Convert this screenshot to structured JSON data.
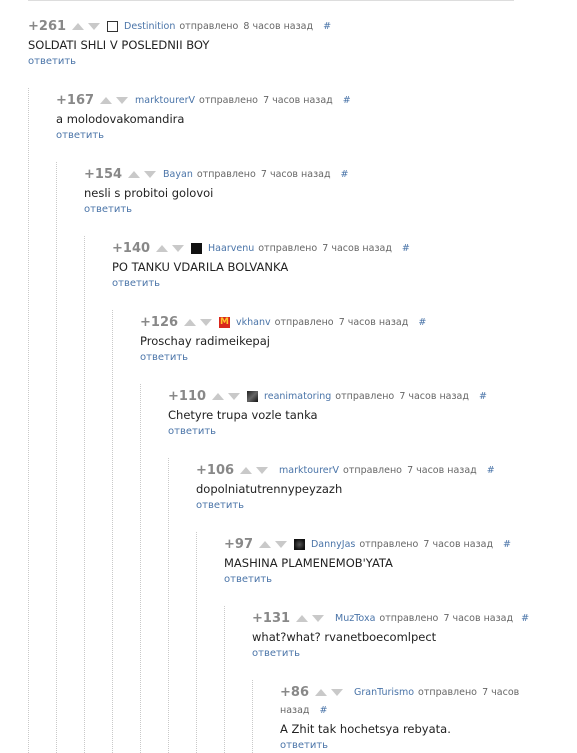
{
  "ui": {
    "reply_label": "ответить",
    "hash_label": "#",
    "posted_label": "отправлено"
  },
  "comments": [
    {
      "score": "+261",
      "user": "Destinition",
      "time": "8 часов назад",
      "text": "SOLDATI SHLI V POSLEDNII BOY",
      "avatar": "photo"
    },
    {
      "score": "+167",
      "user": "marktourerV",
      "time": "7 часов назад",
      "text": "a molodovakomandira",
      "avatar": "none"
    },
    {
      "score": "+154",
      "user": "Bayan",
      "time": "7 часов назад",
      "text": "nesli s probitoi golovoi",
      "avatar": "none"
    },
    {
      "score": "+140",
      "user": "Haarvenu",
      "time": "7 часов назад",
      "text": "PO TANKU VDARILA BOLVANKA",
      "avatar": "dark"
    },
    {
      "score": "+126",
      "user": "vkhanv",
      "time": "7 часов назад",
      "text": "Proschay radimeikepaj",
      "avatar": "mcd"
    },
    {
      "score": "+110",
      "user": "reanimatoring",
      "time": "7 часов назад",
      "text": "Chetyre trupa vozle tanka",
      "avatar": "dark"
    },
    {
      "score": "+106",
      "user": "marktourerV",
      "time": "7 часов назад",
      "text": "dopolniatutrennypeyzazh",
      "avatar": "none"
    },
    {
      "score": "+97",
      "user": "DannyJas",
      "time": "7 часов назад",
      "text": "MASHINA PLAMENEMOB'YATA",
      "avatar": "dark"
    },
    {
      "score": "+131",
      "user": "MuzToxa",
      "time": "7 часов назад",
      "text": "what?what? rvanetboecomlpect",
      "avatar": "none"
    },
    {
      "score": "+86",
      "user": "GranTurismo",
      "time": "7 часов назад",
      "text": "A Zhit tak hochetsya rebyata.",
      "avatar": "none"
    }
  ]
}
